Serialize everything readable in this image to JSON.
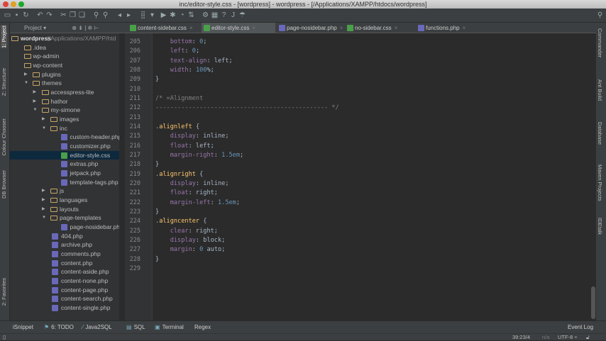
{
  "window": {
    "title": "inc/editor-style.css - [wordpress] - wordpress - [/Applications/XAMPP/htdocs/wordpress]"
  },
  "toolbar": {
    "icons": [
      "open-icon",
      "save-icon",
      "sync-icon",
      "undo-icon",
      "redo-icon",
      "cut-icon",
      "copy-icon",
      "paste-icon",
      "find-icon",
      "replace-icon",
      "back-icon",
      "forward-icon",
      "build-icon",
      "run-config-dropdown",
      "run-icon",
      "debug-icon",
      "profile-icon",
      "vcs-icon",
      "settings-icon",
      "structure-icon",
      "help-icon",
      "jdi-icon",
      "plugin-icon"
    ],
    "search_icon": "search-icon"
  },
  "project_panel": {
    "label": "Project"
  },
  "tabs": [
    {
      "label": "content-sidebar.css",
      "type": "css",
      "active": false
    },
    {
      "label": "editor-style.css",
      "type": "css",
      "active": true
    },
    {
      "label": "page-nosidebar.php",
      "type": "php",
      "active": false
    },
    {
      "label": "no-sidebar.css",
      "type": "css",
      "active": false
    },
    {
      "label": "functions.php",
      "type": "php",
      "active": false
    }
  ],
  "left_tool_windows": [
    "1: Project",
    "Z: Structure",
    "Colour Chooser",
    "DB Browser",
    "2: Favorites"
  ],
  "right_tool_windows": [
    "Commander",
    "Ant Build",
    "Database",
    "Maven Projects",
    "IDEtalk"
  ],
  "tree": [
    {
      "name": "wordpress",
      "suffix": " (/Applications/XAMPP/htd",
      "kind": "root",
      "depth": 0
    },
    {
      "name": ".idea",
      "kind": "folder",
      "depth": 1
    },
    {
      "name": "wp-admin",
      "kind": "folder",
      "depth": 1
    },
    {
      "name": "wp-content",
      "kind": "folder",
      "depth": 1
    },
    {
      "name": "plugins",
      "kind": "folder",
      "depth": 2,
      "arrow": "closed"
    },
    {
      "name": "themes",
      "kind": "folder",
      "depth": 2,
      "arrow": "open"
    },
    {
      "name": "accesspress-lite",
      "kind": "folder",
      "depth": 3,
      "arrow": "closed"
    },
    {
      "name": "hathor",
      "kind": "folder",
      "depth": 3,
      "arrow": "closed"
    },
    {
      "name": "my-simone",
      "kind": "folder",
      "depth": 3,
      "arrow": "open"
    },
    {
      "name": "images",
      "kind": "folder",
      "depth": 4,
      "arrow": "closed"
    },
    {
      "name": "inc",
      "kind": "folder",
      "depth": 4,
      "arrow": "open"
    },
    {
      "name": "custom-header.php",
      "kind": "php",
      "depth": 5
    },
    {
      "name": "customizer.php",
      "kind": "php",
      "depth": 5
    },
    {
      "name": "editor-style.css",
      "kind": "css",
      "depth": 5,
      "selected": true
    },
    {
      "name": "extras.php",
      "kind": "php",
      "depth": 5
    },
    {
      "name": "jetpack.php",
      "kind": "php",
      "depth": 5
    },
    {
      "name": "template-tags.php",
      "kind": "php",
      "depth": 5
    },
    {
      "name": "js",
      "kind": "folder",
      "depth": 4,
      "arrow": "closed"
    },
    {
      "name": "languages",
      "kind": "folder",
      "depth": 4,
      "arrow": "closed"
    },
    {
      "name": "layouts",
      "kind": "folder",
      "depth": 4,
      "arrow": "closed"
    },
    {
      "name": "page-templates",
      "kind": "folder",
      "depth": 4,
      "arrow": "open"
    },
    {
      "name": "page-nosidebar.php",
      "kind": "php",
      "depth": 5
    },
    {
      "name": "404.php",
      "kind": "php",
      "depth": 4
    },
    {
      "name": "archive.php",
      "kind": "php",
      "depth": 4
    },
    {
      "name": "comments.php",
      "kind": "php",
      "depth": 4
    },
    {
      "name": "content.php",
      "kind": "php",
      "depth": 4
    },
    {
      "name": "content-aside.php",
      "kind": "php",
      "depth": 4
    },
    {
      "name": "content-none.php",
      "kind": "php",
      "depth": 4
    },
    {
      "name": "content-page.php",
      "kind": "php",
      "depth": 4
    },
    {
      "name": "content-search.php",
      "kind": "php",
      "depth": 4
    },
    {
      "name": "content-single.php",
      "kind": "php",
      "depth": 4
    }
  ],
  "code": [
    {
      "n": "205",
      "t": [
        [
          "    ",
          ""
        ],
        [
          "bottom",
          "prop"
        ],
        [
          ": ",
          "val"
        ],
        [
          "0",
          "num"
        ],
        [
          ";",
          "val"
        ]
      ]
    },
    {
      "n": "206",
      "t": [
        [
          "    ",
          ""
        ],
        [
          "left",
          "prop"
        ],
        [
          ": ",
          "val"
        ],
        [
          "0",
          "num"
        ],
        [
          ";",
          "val"
        ]
      ]
    },
    {
      "n": "207",
      "t": [
        [
          "    ",
          ""
        ],
        [
          "text-align",
          "prop"
        ],
        [
          ": left;",
          "val"
        ]
      ]
    },
    {
      "n": "208",
      "t": [
        [
          "    ",
          ""
        ],
        [
          "width",
          "prop"
        ],
        [
          ": ",
          "val"
        ],
        [
          "100",
          "num"
        ],
        [
          "%;",
          "val"
        ]
      ]
    },
    {
      "n": "209",
      "t": [
        [
          "}",
          "val"
        ]
      ]
    },
    {
      "n": "210",
      "t": []
    },
    {
      "n": "211",
      "t": [
        [
          "/* =Alignment",
          "com"
        ]
      ]
    },
    {
      "n": "212",
      "t": [
        [
          "----------------------------------------------- */",
          "com"
        ]
      ]
    },
    {
      "n": "213",
      "t": []
    },
    {
      "n": "214",
      "t": [
        [
          ".",
          "val"
        ],
        [
          "alignleft",
          "sel"
        ],
        [
          " {",
          "val"
        ]
      ]
    },
    {
      "n": "215",
      "t": [
        [
          "    ",
          ""
        ],
        [
          "display",
          "prop"
        ],
        [
          ": inline;",
          "val"
        ]
      ]
    },
    {
      "n": "216",
      "t": [
        [
          "    ",
          ""
        ],
        [
          "float",
          "prop"
        ],
        [
          ": left;",
          "val"
        ]
      ]
    },
    {
      "n": "217",
      "t": [
        [
          "    ",
          ""
        ],
        [
          "margin-right",
          "prop"
        ],
        [
          ": ",
          "val"
        ],
        [
          "1.5em",
          "num"
        ],
        [
          ";",
          "val"
        ]
      ]
    },
    {
      "n": "218",
      "t": [
        [
          "}",
          "val"
        ]
      ]
    },
    {
      "n": "219",
      "t": [
        [
          ".",
          "val"
        ],
        [
          "alignright",
          "sel"
        ],
        [
          " {",
          "val"
        ]
      ]
    },
    {
      "n": "220",
      "t": [
        [
          "    ",
          ""
        ],
        [
          "display",
          "prop"
        ],
        [
          ": inline;",
          "val"
        ]
      ]
    },
    {
      "n": "221",
      "t": [
        [
          "    ",
          ""
        ],
        [
          "float",
          "prop"
        ],
        [
          ": right;",
          "val"
        ]
      ]
    },
    {
      "n": "222",
      "t": [
        [
          "    ",
          ""
        ],
        [
          "margin-left",
          "prop"
        ],
        [
          ": ",
          "val"
        ],
        [
          "1.5em",
          "num"
        ],
        [
          ";",
          "val"
        ]
      ]
    },
    {
      "n": "223",
      "t": [
        [
          "}",
          "val"
        ]
      ]
    },
    {
      "n": "224",
      "t": [
        [
          ".",
          "val"
        ],
        [
          "aligncenter",
          "sel"
        ],
        [
          " {",
          "val"
        ]
      ]
    },
    {
      "n": "225",
      "t": [
        [
          "    ",
          ""
        ],
        [
          "clear",
          "prop"
        ],
        [
          ": right;",
          "val"
        ]
      ]
    },
    {
      "n": "226",
      "t": [
        [
          "    ",
          ""
        ],
        [
          "display",
          "prop"
        ],
        [
          ": block;",
          "val"
        ]
      ]
    },
    {
      "n": "227",
      "t": [
        [
          "    ",
          ""
        ],
        [
          "margin",
          "prop"
        ],
        [
          ": ",
          "val"
        ],
        [
          "0",
          "num"
        ],
        [
          " auto;",
          "val"
        ]
      ]
    },
    {
      "n": "228",
      "t": [
        [
          "}",
          "val"
        ]
      ]
    },
    {
      "n": "229",
      "t": []
    }
  ],
  "bottom_tools": [
    "iSnippet",
    "6: TODO",
    "Java2SQL",
    "SQL",
    "Terminal",
    "Regex"
  ],
  "event_log": "Event Log",
  "status": {
    "position": "39:23/4",
    "line_sep": "n/a",
    "encoding": "UTF-8 ÷"
  },
  "colors": {
    "accent": "#0d293e",
    "selector": "#ffc66d",
    "property": "#9876aa",
    "number": "#6897bb"
  }
}
